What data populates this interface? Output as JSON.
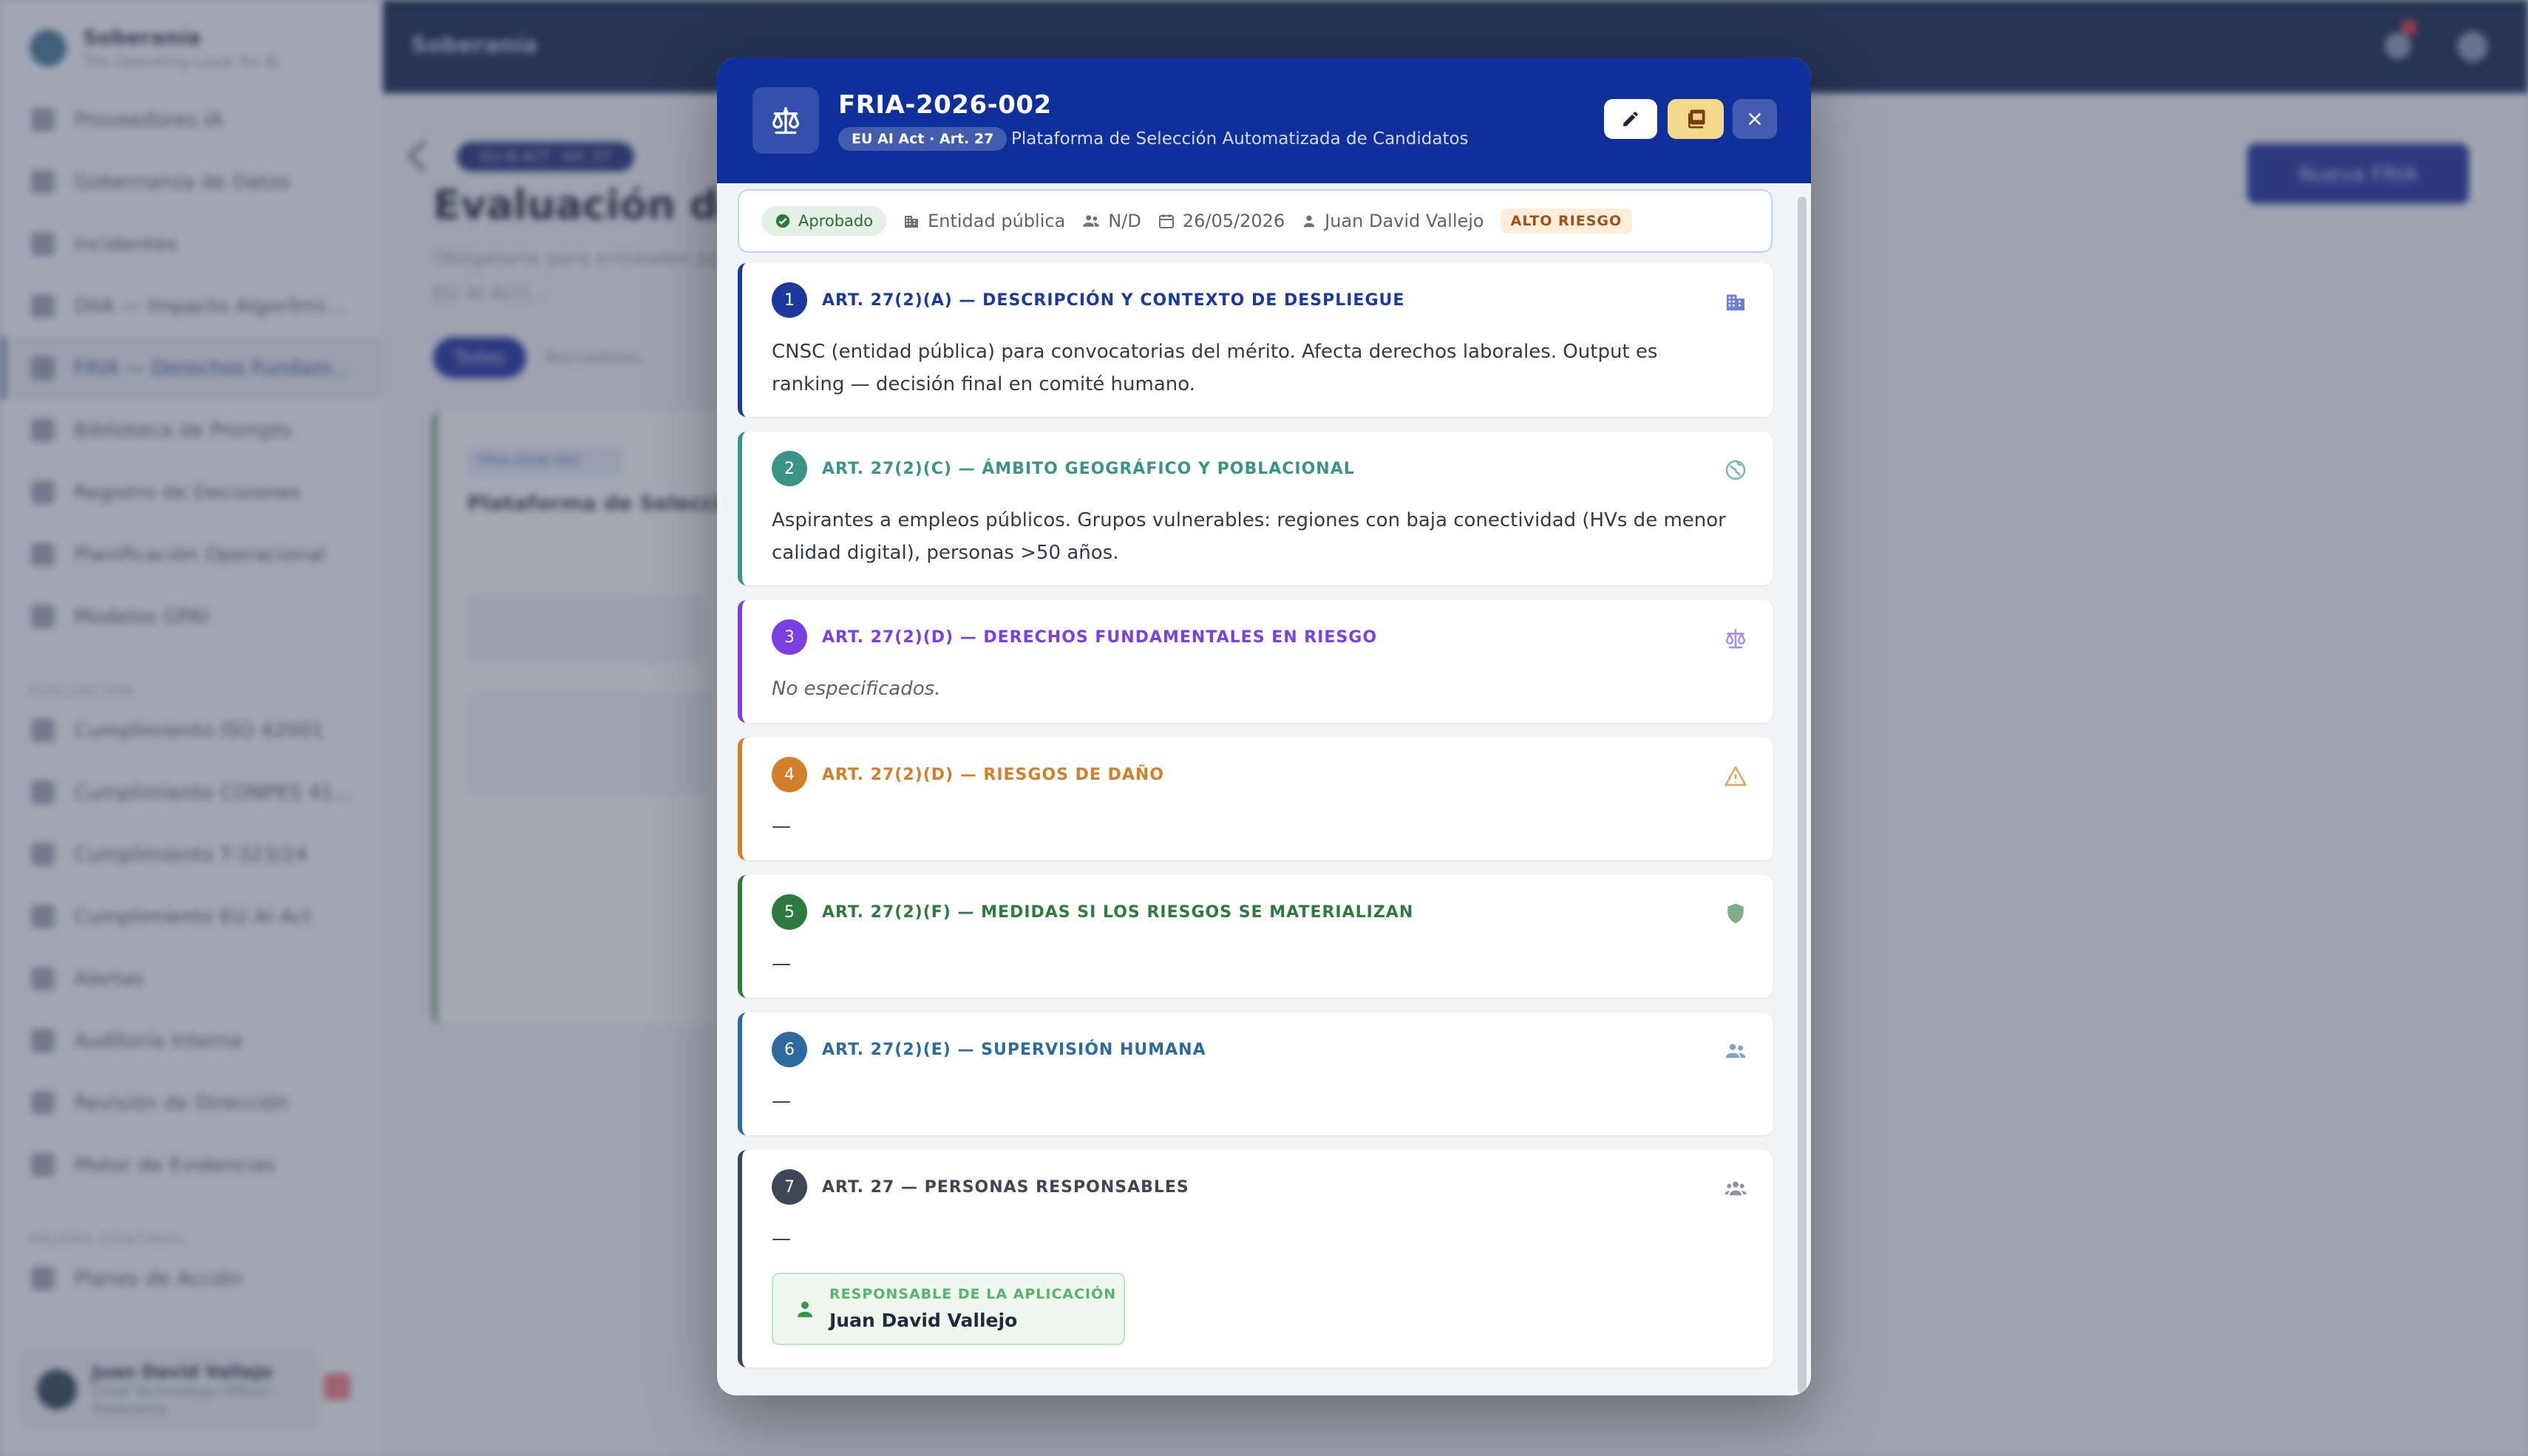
{
  "background": {
    "brand": {
      "name": "Soberanía",
      "tagline": "The Operating Layer for AI"
    },
    "nav_items": [
      {
        "label": "Proveedores IA"
      },
      {
        "label": "Gobernanza de Datos"
      },
      {
        "label": "Incidentes"
      },
      {
        "label": "DIIA — Impacto Algorítmi..."
      },
      {
        "label": "FRIA — Derechos Fundam...",
        "active": true
      },
      {
        "label": "Biblioteca de Prompts"
      },
      {
        "label": "Registro de Decisiones"
      },
      {
        "label": "Planificación Operacional"
      },
      {
        "label": "Modelos GPAI"
      }
    ],
    "section_eval": "EVALUACIÓN",
    "nav_eval": [
      {
        "label": "Cumplimiento ISO 42001"
      },
      {
        "label": "Cumplimiento CONPES 41..."
      },
      {
        "label": "Cumplimiento T-323/24"
      },
      {
        "label": "Cumplimiento EU AI Act"
      },
      {
        "label": "Alertas"
      },
      {
        "label": "Auditoría Interna"
      },
      {
        "label": "Revisión de Dirección"
      },
      {
        "label": "Motor de Evidencias"
      }
    ],
    "section_mejora": "MEJORA CONTINUA",
    "nav_mejora": [
      {
        "label": "Planes de Acción"
      }
    ],
    "user": {
      "name": "Juan David Vallejo",
      "role": "Chief Technology Officer",
      "org": "Soberanía"
    },
    "topbar_title": "Soberanía",
    "page_chip": "EU AI ACT · Art. 27",
    "page_title": "Evaluación de I",
    "page_subtitle": "Obligatoria para entidades pú... alto riesgo (Art. 27 EU AI Act)...",
    "filter_all": "Todas",
    "filter_drafts": "Borradores",
    "new_button": "Nueva FRIA",
    "card_chip": "FRIA-2026-002",
    "card_title": "Plataforma de Selecció"
  },
  "modal": {
    "code": "FRIA-2026-002",
    "regulation_chip": "EU AI Act · Art. 27",
    "system_name": "Plataforma de Selección Automatizada de Candidatos",
    "meta": {
      "status": "Aprobado",
      "entity_type": "Entidad pública",
      "affected": "N/D",
      "date": "26/05/2026",
      "owner": "Juan David Vallejo",
      "risk": "ALTO RIESGO"
    },
    "sections": [
      {
        "num": "1",
        "title": "ART. 27(2)(A) — DESCRIPCIÓN Y CONTEXTO DE DESPLIEGUE",
        "text": "CNSC (entidad pública) para convocatorias del mérito. Afecta derechos laborales. Output es ranking — decisión final en comité humano.",
        "color": "#1c3a9e",
        "icon": "building-icon"
      },
      {
        "num": "2",
        "title": "ART. 27(2)(C) — ÁMBITO GEOGRÁFICO Y POBLACIONAL",
        "text": "Aspirantes a empleos públicos. Grupos vulnerables: regiones con baja conectividad (HVs de menor calidad digital), personas >50 años.",
        "color": "#3c9488",
        "icon": "globe-icon"
      },
      {
        "num": "3",
        "title": "ART. 27(2)(D) — DERECHOS FUNDAMENTALES EN RIESGO",
        "text": "No especificados.",
        "color": "#7b3fe4",
        "icon": "scales-icon"
      },
      {
        "num": "4",
        "title": "ART. 27(2)(D) — RIESGOS DE DAÑO",
        "text": "—",
        "color": "#d0802a",
        "icon": "warning-icon"
      },
      {
        "num": "5",
        "title": "ART. 27(2)(F) — MEDIDAS SI LOS RIESGOS SE MATERIALIZAN",
        "text": "—",
        "color": "#2f7a3e",
        "icon": "shield-icon"
      },
      {
        "num": "6",
        "title": "ART. 27(2)(E) — SUPERVISIÓN HUMANA",
        "text": "—",
        "color": "#2d6a9e",
        "icon": "people-icon"
      },
      {
        "num": "7",
        "title": "ART. 27 — PERSONAS RESPONSABLES",
        "text": "—",
        "color": "#3f4756",
        "icon": "group-icon"
      }
    ],
    "responsible": {
      "label": "RESPONSABLE DE LA APLICACIÓN",
      "name": "Juan David Vallejo"
    }
  }
}
